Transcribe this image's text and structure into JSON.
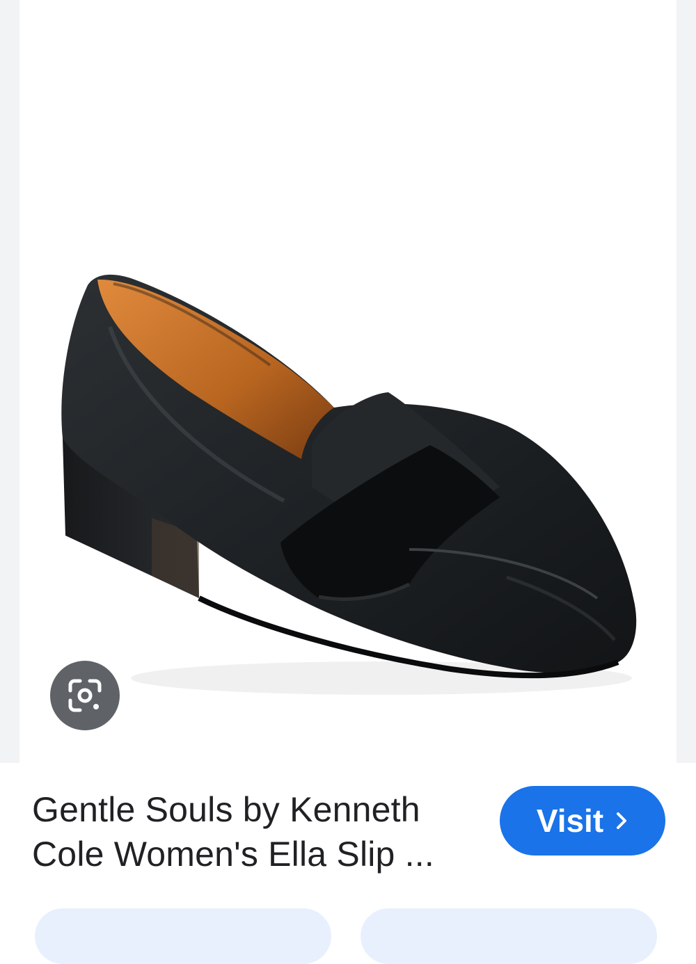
{
  "product": {
    "title_line1": "Gentle Souls by Kenneth",
    "title_line2": "Cole Women's Ella Slip ...",
    "image_alt": "Black leather block-heel loafer"
  },
  "actions": {
    "visit_label": "Visit",
    "visit_icon": "chevron-right-icon",
    "lens_icon": "google-lens-icon"
  },
  "colors": {
    "accent": "#1a73e8",
    "lens_bg": "#5f6368",
    "chip_bg": "#e8f0fe"
  }
}
